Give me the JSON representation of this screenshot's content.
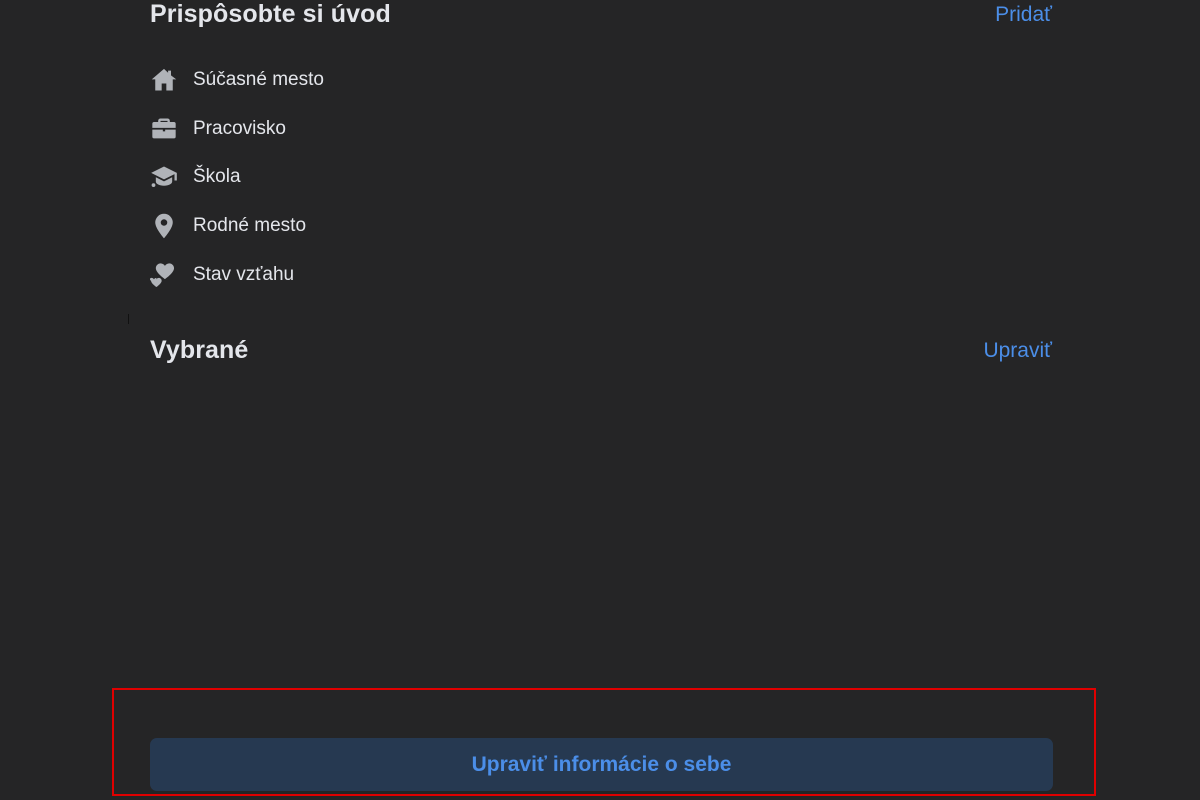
{
  "intro": {
    "title": "Prispôsobte si úvod",
    "add_label": "Pridať",
    "items": [
      {
        "icon": "home-icon",
        "label": "Súčasné mesto"
      },
      {
        "icon": "briefcase-icon",
        "label": "Pracovisko"
      },
      {
        "icon": "graduation-cap-icon",
        "label": "Škola"
      },
      {
        "icon": "location-pin-icon",
        "label": "Rodné mesto"
      },
      {
        "icon": "hearts-icon",
        "label": "Stav vzťahu"
      }
    ]
  },
  "featured": {
    "title": "Vybrané",
    "edit_label": "Upraviť"
  },
  "edit_button": {
    "label": "Upraviť informácie o sebe"
  },
  "colors": {
    "background": "#252526",
    "text": "#e4e6eb",
    "link": "#4b8ee8",
    "icon": "#b0b3b8",
    "button_bg": "#263951",
    "highlight": "#e00000"
  }
}
